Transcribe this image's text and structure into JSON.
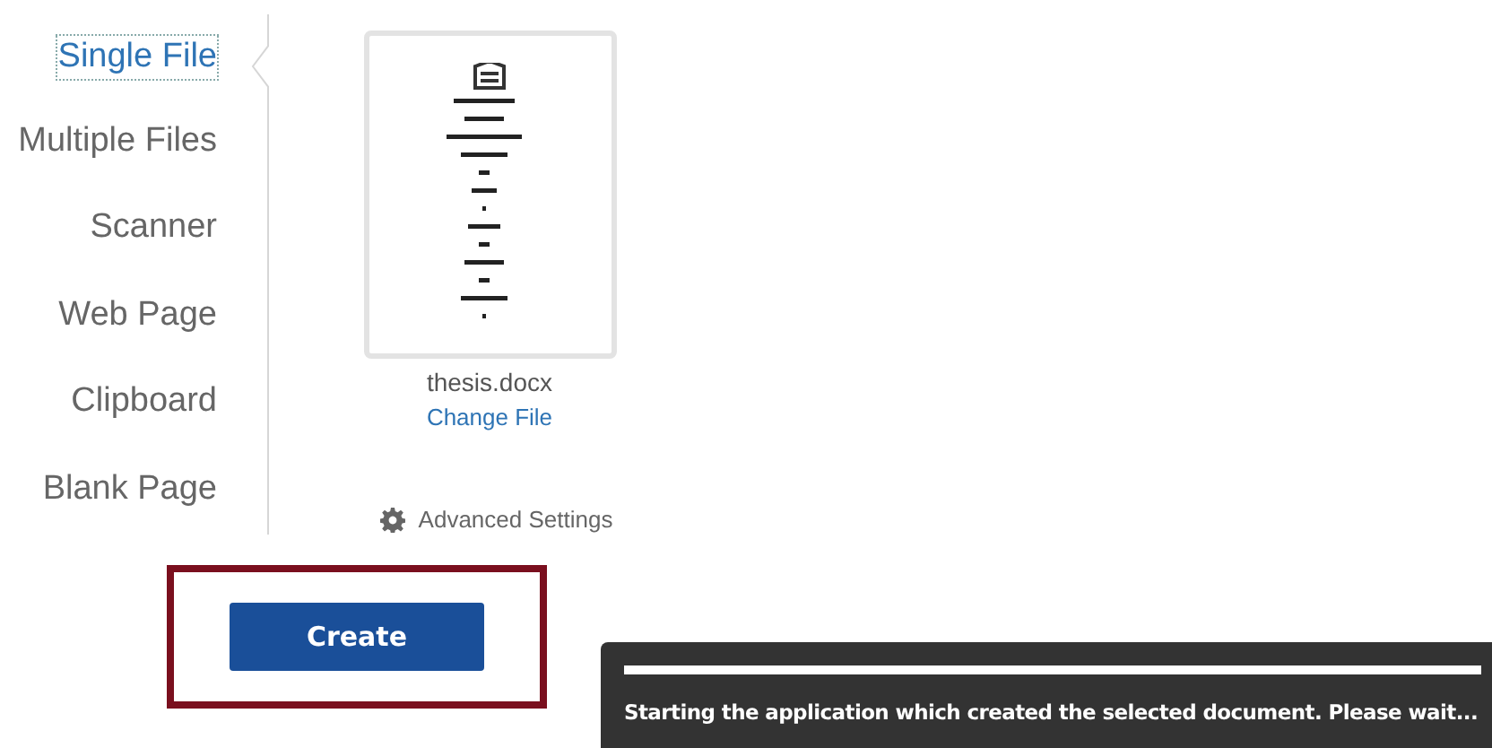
{
  "sidebar": {
    "items": [
      {
        "label": "Single File",
        "selected": true
      },
      {
        "label": "Multiple Files",
        "selected": false
      },
      {
        "label": "Scanner",
        "selected": false
      },
      {
        "label": "Web Page",
        "selected": false
      },
      {
        "label": "Clipboard",
        "selected": false
      },
      {
        "label": "Blank Page",
        "selected": false
      }
    ]
  },
  "file": {
    "name": "thesis.docx",
    "change_link": "Change File"
  },
  "advanced_settings": "Advanced Settings",
  "create_button": {
    "label": "Create",
    "highlighted": true
  },
  "toast": {
    "level": 1,
    "message": "Starting the application which created the selected document. Please wait..."
  }
}
